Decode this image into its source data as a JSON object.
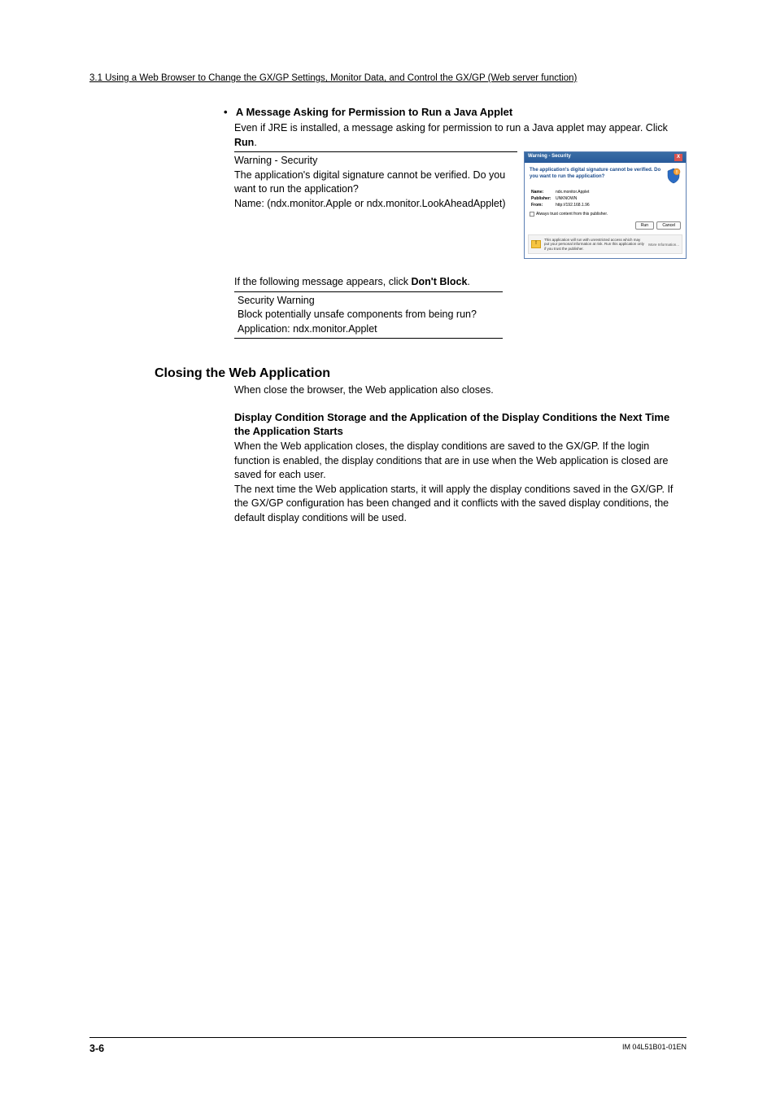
{
  "header": "3.1  Using a Web Browser to Change the GX/GP Settings, Monitor Data, and Control the GX/GP (Web server function)",
  "bullet_prefix": "•",
  "h2": "A Message Asking for Permission to Run a Java Applet",
  "intro_a": "Even if JRE is installed, a message asking for permission to run a Java applet may appear. Click ",
  "intro_b": "Run",
  "intro_c": ".",
  "msg1_l1": "Warning - Security",
  "msg1_l2": "The application's digital signature cannot be verified. Do you want to run the application?",
  "msg1_l3": "Name: (ndx.monitor.Apple or ndx.monitor.LookAheadApplet)",
  "dialog": {
    "title": "Warning - Security",
    "close": "X",
    "question": "The application's digital signature cannot be verified. Do you want to run the application?",
    "name_lbl": "Name:",
    "name_val": "ndx.monitor.Applet",
    "pub_lbl": "Publisher:",
    "pub_val": "UNKNOWN",
    "from_lbl": "From:",
    "from_val": "http://192.168.1.96",
    "always": "Always trust content from this publisher.",
    "run": "Run",
    "cancel": "Cancel",
    "warn_text": "This application will run with unrestricted access which may put your personal information at risk. Run this application only if you trust the publisher.",
    "more": "More Information..."
  },
  "follow_a": "If the following message appears, click ",
  "follow_b": "Don't Block",
  "follow_c": ".",
  "msg2_l1": "Security Warning",
  "msg2_l2": "Block potentially unsafe components from being run?",
  "msg2_l3": "Application: ndx.monitor.Applet",
  "h1": "Closing the Web Application",
  "close_para": "When close the browser, the Web application also closes.",
  "h3": "Display Condition Storage and the Application of the Display Conditions the Next Time the Application Starts",
  "disp_p1": "When the Web application closes, the display conditions are saved to the GX/GP. If the login function is enabled, the display conditions that are in use when the Web application is closed are saved for each user.",
  "disp_p2": "The next time the Web application starts, it will apply the display conditions saved in the GX/GP. If the GX/GP configuration has been changed and it conflicts with the saved display conditions, the default display conditions will be used.",
  "footer_page": "3-6",
  "footer_doc": "IM 04L51B01-01EN"
}
